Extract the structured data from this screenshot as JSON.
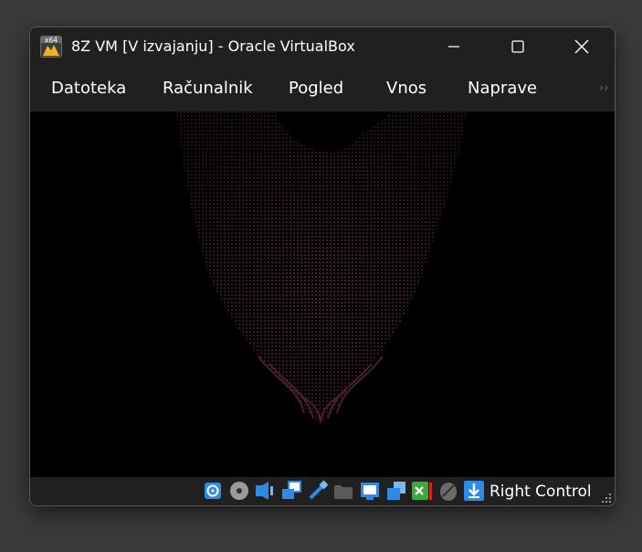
{
  "window": {
    "title": "8Z VM [V izvajanju] - Oracle VirtualBox",
    "app_icon_label": "x64"
  },
  "menu": {
    "items": [
      "Datoteka",
      "Računalnik",
      "Pogled",
      "Vnos",
      "Naprave"
    ],
    "overflow_glyph": "››"
  },
  "vm_display": {
    "content": "dark maroon heart-shaped particle pattern on black",
    "particle_color": "#5a2a32",
    "background_color": "#000000"
  },
  "statusbar": {
    "indicators": [
      "hard-disk-icon",
      "optical-drive-icon",
      "audio-icon",
      "network-icon",
      "usb-icon",
      "shared-folders-icon",
      "display-icon",
      "video-capture-icon",
      "guest-additions-icon",
      "mouse-integration-icon",
      "keyboard-capture-icon"
    ],
    "host_key": "Right Control"
  },
  "colors": {
    "chrome": "#202020",
    "accent_blue": "#2d8ae6",
    "text": "#ffffff"
  }
}
